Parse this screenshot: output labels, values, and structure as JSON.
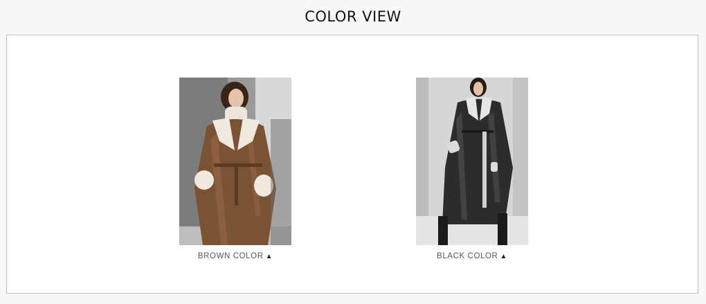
{
  "page": {
    "title": "COLOR VIEW"
  },
  "colors": [
    {
      "label": "BROWN COLOR",
      "icon": "triangle-up-icon",
      "swatch": "#7a5234"
    },
    {
      "label": "BLACK COLOR",
      "icon": "triangle-up-icon",
      "swatch": "#2a2a2a"
    }
  ],
  "icon_glyph": "▲"
}
